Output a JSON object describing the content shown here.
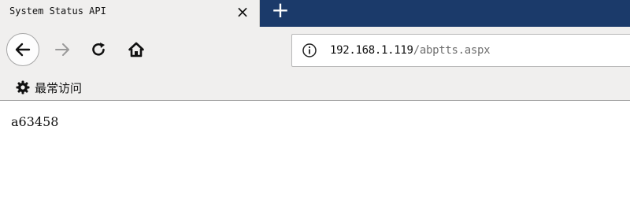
{
  "tab": {
    "title": "System Status API",
    "close_label": "×",
    "close_icon": "close-icon",
    "new_tab_label": "+",
    "new_tab_icon": "plus-icon"
  },
  "toolbar": {
    "back_icon": "back-arrow-icon",
    "forward_icon": "forward-arrow-icon",
    "reload_icon": "reload-icon",
    "home_icon": "home-icon"
  },
  "urlbar": {
    "info_icon": "info-icon",
    "host": "192.168.1.119",
    "path": "/abptts.aspx"
  },
  "bookmarks": {
    "items": [
      {
        "icon": "gear-icon",
        "label": "最常访问"
      }
    ]
  },
  "page": {
    "body_text": "a63458"
  },
  "colors": {
    "tabstrip_bg": "#1b3a6a",
    "chrome_bg": "#f0efee",
    "url_path": "#6f6f6f"
  }
}
